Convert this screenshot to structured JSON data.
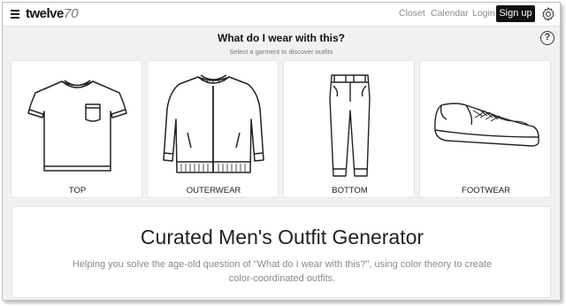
{
  "header": {
    "logo_main": "twelve",
    "logo_num": "70",
    "nav": {
      "closet": "Closet",
      "calendar": "Calendar",
      "login": "Login"
    },
    "signup_label": "Sign up",
    "icons": {
      "menu": "hamburger-icon",
      "settings": "gear-icon"
    }
  },
  "picker": {
    "title": "What do I wear with this?",
    "subtitle": "Select a garment to discover outfits",
    "help_label": "?",
    "categories": [
      {
        "label": "TOP",
        "icon": "tshirt-icon"
      },
      {
        "label": "OUTERWEAR",
        "icon": "jacket-icon"
      },
      {
        "label": "BOTTOM",
        "icon": "pants-icon"
      },
      {
        "label": "FOOTWEAR",
        "icon": "sneaker-icon"
      }
    ]
  },
  "hero": {
    "title": "Curated Men's Outfit Generator",
    "text": "Helping you solve the age-old question of \"What do I wear with this?\", using color theory to create color-coordinated outfits."
  },
  "colors": {
    "signup_bg": "#111111",
    "page_bg": "#f1f1f1",
    "card_bg": "#ffffff",
    "muted_text": "#8a8a8a"
  }
}
